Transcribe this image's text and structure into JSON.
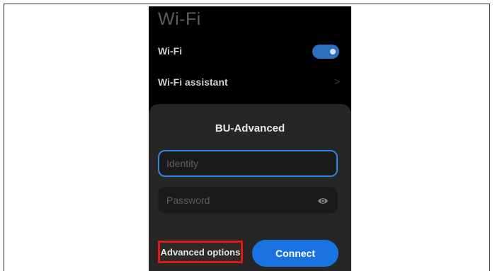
{
  "header": {
    "title": "Wi-Fi"
  },
  "settings": {
    "wifi_label": "Wi-Fi",
    "wifi_enabled": true,
    "assistant_label": "Wi-Fi assistant",
    "assistant_chevron": ">"
  },
  "dialog": {
    "network_name": "BU-Advanced",
    "identity_placeholder": "Identity",
    "password_placeholder": "Password",
    "advanced_label": "Advanced options",
    "connect_label": "Connect"
  },
  "colors": {
    "accent": "#1a73e0",
    "focus_border": "#2f86e6",
    "highlight": "#e01818"
  },
  "icons": [
    "chevron-right-icon",
    "eye-icon"
  ]
}
